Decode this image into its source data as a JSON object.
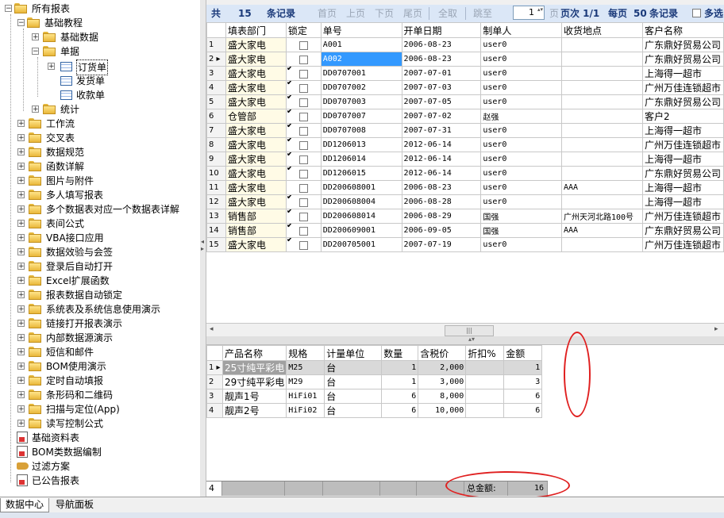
{
  "tree": {
    "root": "所有报表",
    "basic_tutorial": "基础教程",
    "basic_data": "基础数据",
    "bills": "单据",
    "order": "订货单",
    "delivery": "发货单",
    "receipt": "收款单",
    "stats": "统计",
    "items": [
      "工作流",
      "交叉表",
      "数据规范",
      "函数详解",
      "图片与附件",
      "多人填写报表",
      "多个数据表对应一个数据表详解",
      "表间公式",
      "VBA接口应用",
      "数据效验与会签",
      "登录后自动打开",
      "Excel扩展函数",
      "报表数据自动锁定",
      "系统表及系统信息使用演示",
      "链接打开报表演示",
      "内部数据源演示",
      "短信和邮件",
      "BOM使用演示",
      "定时自动填报",
      "条形码和二维码",
      "扫描与定位(App)",
      "读写控制公式"
    ],
    "bottom": [
      "基础资料表",
      "BOM类数据编制",
      "过滤方案",
      "已公告报表"
    ]
  },
  "toolbar": {
    "total_label": "共",
    "total_count": "15",
    "records_label": "条记录",
    "first": "首页",
    "prev": "上页",
    "next": "下页",
    "last": "尾页",
    "select_all": "全取",
    "goto": "跳至",
    "page_value": "1",
    "page_suffix": "页",
    "page_info": "页次 1/1",
    "per_page_label": "每页",
    "per_page": "50",
    "per_page_suffix": "条记录",
    "multi_select": "多选"
  },
  "grid1": {
    "headers": [
      "填表部门",
      "锁定",
      "单号",
      "开单日期",
      "制单人",
      "收货地点",
      "客户名称"
    ],
    "rows": [
      {
        "n": "1",
        "dept": "盛大家电",
        "lock": false,
        "no": "A001",
        "date": "2006-08-23",
        "user": "user0",
        "addr": "",
        "cust": "广东鼎好贸易公司"
      },
      {
        "n": "2",
        "dept": "盛大家电",
        "lock": false,
        "no": "A002",
        "date": "2006-08-23",
        "user": "user0",
        "addr": "",
        "cust": "广东鼎好贸易公司"
      },
      {
        "n": "3",
        "dept": "盛大家电",
        "lock": true,
        "no": "DD0707001",
        "date": "2007-07-01",
        "user": "user0",
        "addr": "",
        "cust": "上海得一超市"
      },
      {
        "n": "4",
        "dept": "盛大家电",
        "lock": true,
        "no": "DD0707002",
        "date": "2007-07-03",
        "user": "user0",
        "addr": "",
        "cust": "广州万佳连锁超市"
      },
      {
        "n": "5",
        "dept": "盛大家电",
        "lock": true,
        "no": "DD0707003",
        "date": "2007-07-05",
        "user": "user0",
        "addr": "",
        "cust": "广东鼎好贸易公司"
      },
      {
        "n": "6",
        "dept": "仓管部",
        "lock": true,
        "no": "DD0707007",
        "date": "2007-07-02",
        "user": "赵强",
        "addr": "",
        "cust": "客户2"
      },
      {
        "n": "7",
        "dept": "盛大家电",
        "lock": true,
        "no": "DD0707008",
        "date": "2007-07-31",
        "user": "user0",
        "addr": "",
        "cust": "上海得一超市"
      },
      {
        "n": "8",
        "dept": "盛大家电",
        "lock": true,
        "no": "DD1206013",
        "date": "2012-06-14",
        "user": "user0",
        "addr": "",
        "cust": "广州万佳连锁超市"
      },
      {
        "n": "9",
        "dept": "盛大家电",
        "lock": true,
        "no": "DD1206014",
        "date": "2012-06-14",
        "user": "user0",
        "addr": "",
        "cust": "上海得一超市"
      },
      {
        "n": "10",
        "dept": "盛大家电",
        "lock": true,
        "no": "DD1206015",
        "date": "2012-06-14",
        "user": "user0",
        "addr": "",
        "cust": "广东鼎好贸易公司"
      },
      {
        "n": "11",
        "dept": "盛大家电",
        "lock": false,
        "no": "DD200608001",
        "date": "2006-08-23",
        "user": "user0",
        "addr": "AAA",
        "cust": "上海得一超市"
      },
      {
        "n": "12",
        "dept": "盛大家电",
        "lock": true,
        "no": "DD200608004",
        "date": "2006-08-28",
        "user": "user0",
        "addr": "",
        "cust": "上海得一超市"
      },
      {
        "n": "13",
        "dept": "销售部",
        "lock": true,
        "no": "DD200608014",
        "date": "2006-08-29",
        "user": "国强",
        "addr": "广州天河北路100号",
        "cust": "广州万佳连锁超市"
      },
      {
        "n": "14",
        "dept": "销售部",
        "lock": true,
        "no": "DD200609001",
        "date": "2006-09-05",
        "user": "国强",
        "addr": "AAA",
        "cust": "广东鼎好贸易公司"
      },
      {
        "n": "15",
        "dept": "盛大家电",
        "lock": true,
        "no": "DD200705001",
        "date": "2007-07-19",
        "user": "user0",
        "addr": "",
        "cust": "广州万佳连锁超市"
      }
    ]
  },
  "grid2": {
    "headers": [
      "产品名称",
      "规格",
      "计量单位",
      "数量",
      "含税价",
      "折扣%",
      "金额"
    ],
    "rows": [
      {
        "n": "1",
        "name": "25寸纯平彩电",
        "spec": "M25",
        "unit": "台",
        "qty": "1",
        "price": "2,000",
        "disc": "",
        "amt": "1"
      },
      {
        "n": "2",
        "name": "29寸纯平彩电",
        "spec": "M29",
        "unit": "台",
        "qty": "1",
        "price": "3,000",
        "disc": "",
        "amt": "3"
      },
      {
        "n": "3",
        "name": "靓声1号",
        "spec": "HiFi01",
        "unit": "台",
        "qty": "6",
        "price": "8,000",
        "disc": "",
        "amt": "6"
      },
      {
        "n": "4",
        "name": "靓声2号",
        "spec": "HiFi02",
        "unit": "台",
        "qty": "6",
        "price": "10,000",
        "disc": "",
        "amt": "6"
      }
    ],
    "footer_count": "4",
    "total_label": "总金额:",
    "total_value": "16"
  },
  "tabs": [
    "数据中心",
    "导航面板"
  ],
  "colors": {
    "annotation": "#e02020",
    "selected": "#3399ff",
    "toolbar": "#dbe7f7"
  }
}
